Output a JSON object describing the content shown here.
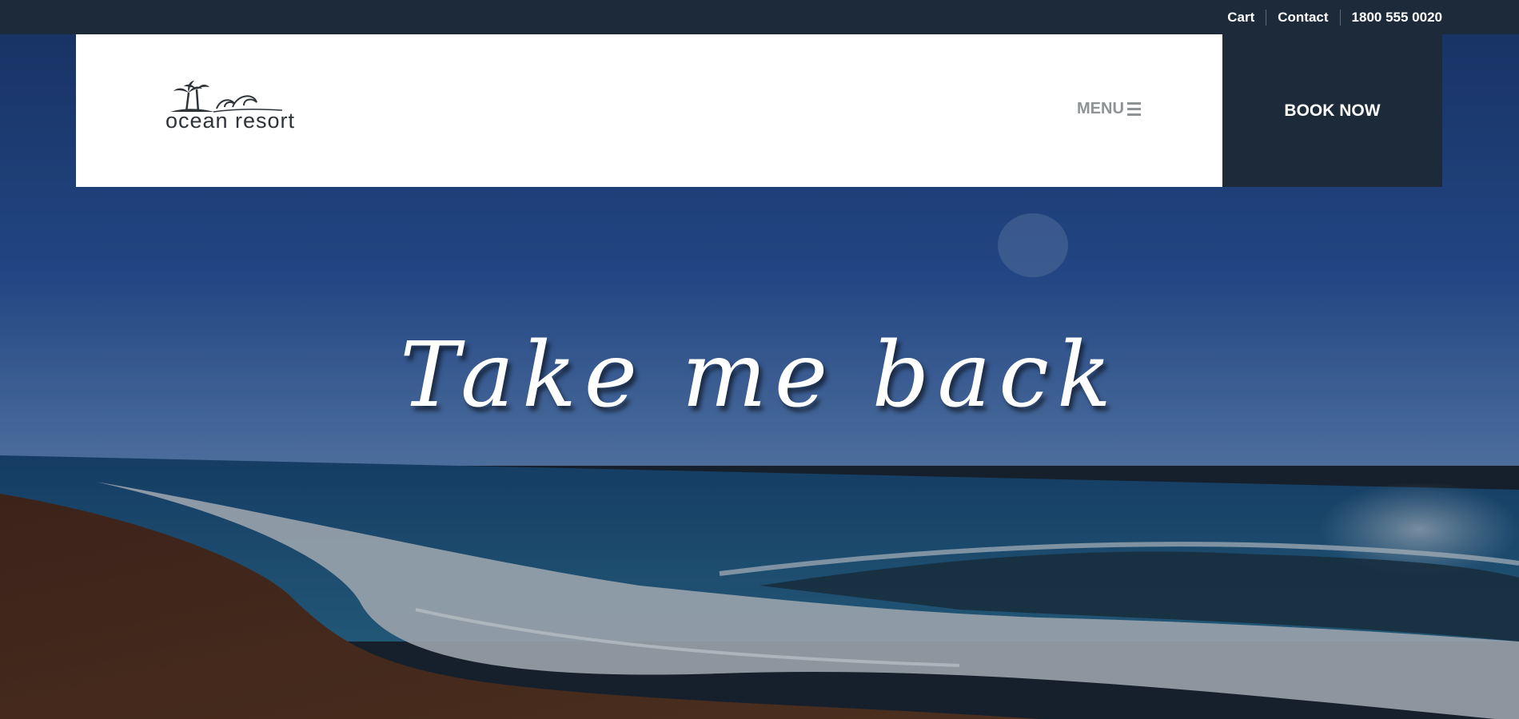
{
  "topbar": {
    "cart": "Cart",
    "contact": "Contact",
    "phone": "1800 555 0020"
  },
  "header": {
    "logo_text": "ocean resort",
    "menu_label": "MENU",
    "book_label": "BOOK NOW"
  },
  "hero": {
    "headline": "Take me back"
  },
  "icons": {
    "logo": "palm-tree-wave-icon",
    "menu": "hamburger-icon"
  },
  "colors": {
    "navy": "#1c2a3a",
    "menu_gray": "#8e9396",
    "sky": "#22478a",
    "sea": "#1d4f7e",
    "sand": "#4f2f22"
  }
}
